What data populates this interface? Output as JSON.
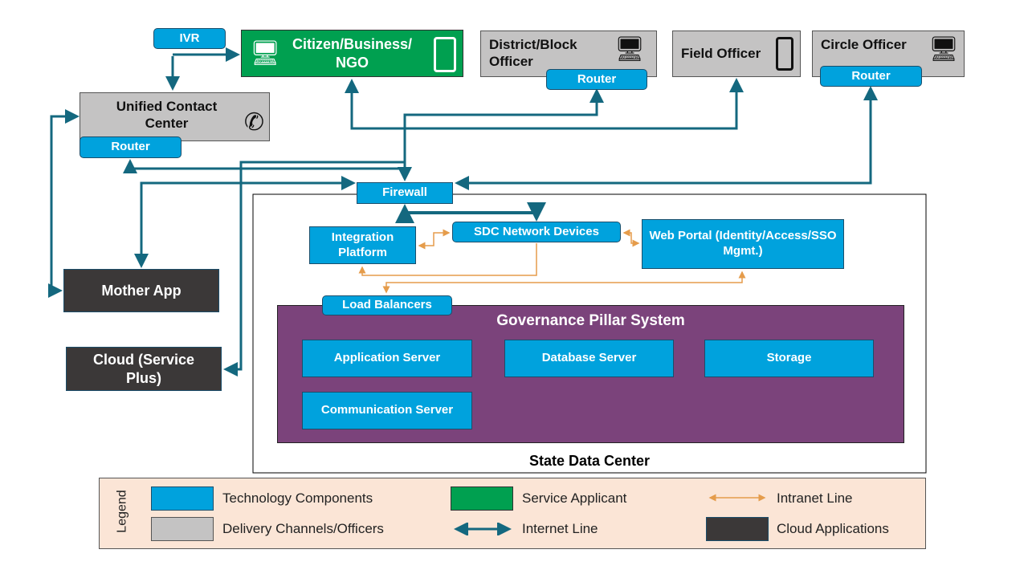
{
  "nodes": {
    "ivr": "IVR",
    "citizen": "Citizen/Business/ NGO",
    "district": "District/Block Officer",
    "field": "Field Officer",
    "circle": "Circle Officer",
    "router": "Router",
    "ucc": "Unified Contact Center",
    "firewall": "Firewall",
    "integration": "Integration Platform",
    "sdc_devices": "SDC Network Devices",
    "web_portal": "Web Portal (Identity/Access/SSO Mgmt.)",
    "load_balancers": "Load Balancers",
    "governance": "Governance Pillar System",
    "app_server": "Application Server",
    "db_server": "Database Server",
    "storage": "Storage",
    "comm_server": "Communication Server",
    "sdc": "State Data Center",
    "mother_app": "Mother App",
    "cloud": "Cloud (Service Plus)"
  },
  "legend": {
    "title": "Legend",
    "items": [
      {
        "label": "Technology Components",
        "color": "#00a2dd"
      },
      {
        "label": "Service Applicant",
        "color": "#00a050"
      },
      {
        "label": "Intranet Line",
        "color": "#e59c4b"
      },
      {
        "label": "Delivery Channels/Officers",
        "color": "#c4c3c3"
      },
      {
        "label": "Internet Line",
        "color": "#14687f"
      },
      {
        "label": "Cloud Applications",
        "color": "#3b3838"
      }
    ]
  },
  "colors": {
    "internet": "#14687f",
    "intranet": "#e59c4b",
    "purple": "#7b437b",
    "legend_bg": "#fbe5d6"
  }
}
